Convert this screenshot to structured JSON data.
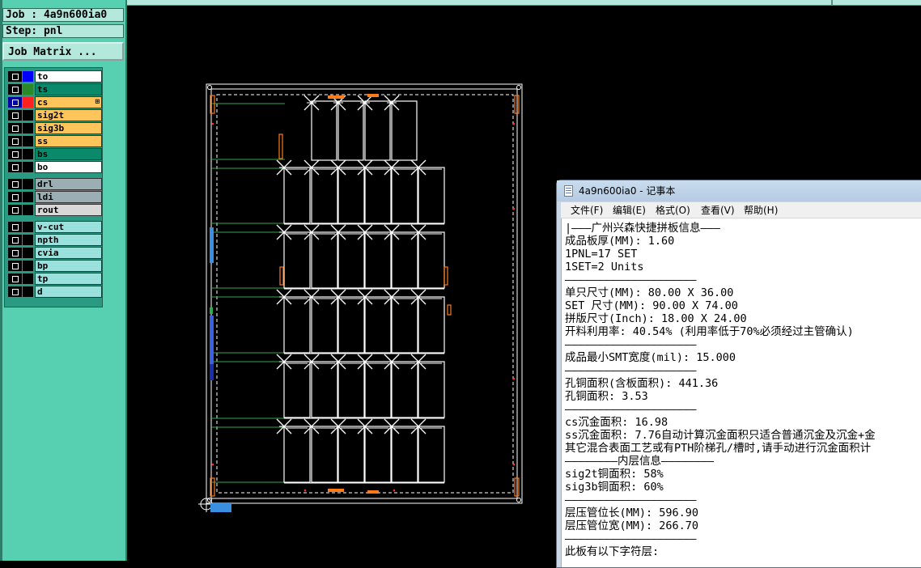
{
  "job_panel": {
    "job_line": "Job : 4a9n600ia0",
    "step_line": "Step: pnl",
    "job_matrix_button": "Job Matrix ..."
  },
  "layers": [
    {
      "name": "to",
      "color": "#ffffff",
      "swatch": "#0000ff",
      "check_color": "#000000",
      "group": 1,
      "flag": ""
    },
    {
      "name": "ts",
      "color": "#0a8a6a",
      "swatch": "#2a8a2a",
      "check_color": "#000000",
      "group": 1,
      "flag": ""
    },
    {
      "name": "cs",
      "color": "#ffc45a",
      "swatch": "#ff2020",
      "check_color": "#0000a0",
      "group": 1,
      "flag": "⊞"
    },
    {
      "name": "sig2t",
      "color": "#ffc45a",
      "swatch": "#000000",
      "check_color": "#000000",
      "group": 1,
      "flag": ""
    },
    {
      "name": "sig3b",
      "color": "#ffc45a",
      "swatch": "#000000",
      "check_color": "#000000",
      "group": 1,
      "flag": ""
    },
    {
      "name": "ss",
      "color": "#ffc45a",
      "swatch": "#000000",
      "check_color": "#000000",
      "group": 1,
      "flag": ""
    },
    {
      "name": "bs",
      "color": "#0a8a6a",
      "swatch": "#000000",
      "check_color": "#000000",
      "group": 1,
      "flag": ""
    },
    {
      "name": "bo",
      "color": "#ffffff",
      "swatch": "#000000",
      "check_color": "#000000",
      "group": 1,
      "flag": ""
    },
    {
      "name": "drl",
      "color": "#9aaeb4",
      "swatch": "#000000",
      "check_color": "#000000",
      "group": 2,
      "flag": ""
    },
    {
      "name": "ldi",
      "color": "#9aaeb4",
      "swatch": "#000000",
      "check_color": "#000000",
      "group": 2,
      "flag": ""
    },
    {
      "name": "rout",
      "color": "#d8d8d8",
      "swatch": "#000000",
      "check_color": "#000000",
      "group": 2,
      "flag": ""
    },
    {
      "name": "v-cut",
      "color": "#9ae0dc",
      "swatch": "#000000",
      "check_color": "#000000",
      "group": 3,
      "flag": ""
    },
    {
      "name": "npth",
      "color": "#9ae0dc",
      "swatch": "#000000",
      "check_color": "#000000",
      "group": 3,
      "flag": ""
    },
    {
      "name": "cvia",
      "color": "#9ae0dc",
      "swatch": "#000000",
      "check_color": "#000000",
      "group": 3,
      "flag": ""
    },
    {
      "name": "bp",
      "color": "#9ae0dc",
      "swatch": "#000000",
      "check_color": "#000000",
      "group": 3,
      "flag": ""
    },
    {
      "name": "tp",
      "color": "#9ae0dc",
      "swatch": "#000000",
      "check_color": "#000000",
      "group": 3,
      "flag": ""
    },
    {
      "name": "d",
      "color": "#9ae0dc",
      "swatch": "#000000",
      "check_color": "#000000",
      "group": 3,
      "flag": ""
    }
  ],
  "notepad": {
    "title": "4a9n600ia0 - 记事本",
    "menus": [
      "文件(F)",
      "编辑(E)",
      "格式(O)",
      "查看(V)",
      "帮助(H)"
    ],
    "lines": [
      "|———广州兴森快捷拼板信息———",
      "成品板厚(MM): 1.60",
      "1PNL=17 SET",
      "1SET=2 Units",
      "————————————————————",
      "单只尺寸(MM): 80.00 X 36.00",
      "SET 尺寸(MM): 90.00 X 74.00",
      "拼版尺寸(Inch): 18.00 X 24.00",
      "开料利用率: 40.54% (利用率低于70%必须经过主管确认)",
      "————————————————————",
      "成品最小SMT宽度(mil): 15.000",
      "————————————————————",
      "孔铜面积(含板面积): 441.36",
      "孔铜面积: 3.53",
      "————————————————————",
      "cs沉金面积: 16.98",
      "ss沉金面积: 7.76自动计算沉金面积只适合普通沉金及沉金+金",
      "其它混合表面工艺或有PTH阶梯孔/槽时,请手动进行沉金面积计",
      "————————内层信息————————",
      "sig2t铜面积: 58%",
      "sig3b铜面积: 60%",
      "————————————————————",
      "层压管位长(MM): 596.90",
      "层压管位宽(MM): 266.70",
      "————————————————————",
      "此板有以下字符层:"
    ]
  },
  "panel_layout": {
    "set_columns": 6,
    "top_row_sets": 4,
    "set_rows": 5
  }
}
